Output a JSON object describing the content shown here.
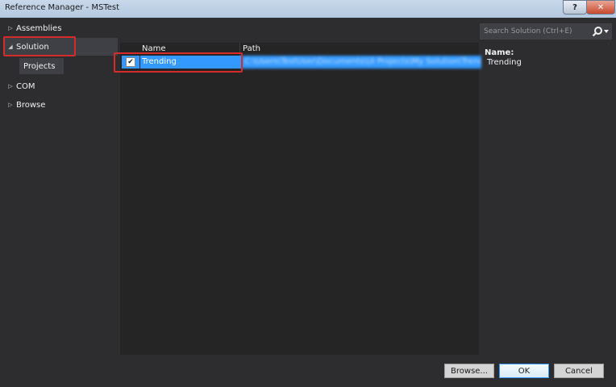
{
  "window": {
    "title": "Reference Manager - MSTest",
    "help_label": "?",
    "close_label": "✕"
  },
  "nav": {
    "items": [
      {
        "label": "Assemblies",
        "expanded": false
      },
      {
        "label": "Solution",
        "expanded": true,
        "selected": true
      },
      {
        "label": "COM",
        "expanded": false
      },
      {
        "label": "Browse",
        "expanded": false
      }
    ],
    "sub_item": "Projects",
    "collapsed_glyph": "▷",
    "expanded_glyph": "◢"
  },
  "grid": {
    "columns": [
      "Name",
      "Path"
    ],
    "rows": [
      {
        "checked": true,
        "check_glyph": "✔",
        "name": "Trending",
        "path": "C:\\Users\\TestUser\\Documents\\UI Projects\\My Solution\\Trending\\Trending.csproj"
      }
    ]
  },
  "search": {
    "placeholder": "Search Solution (Ctrl+E)",
    "value": ""
  },
  "details": {
    "name_label": "Name:",
    "name_value": "Trending"
  },
  "buttons": {
    "browse": "Browse...",
    "ok": "OK",
    "cancel": "Cancel"
  },
  "colors": {
    "background": "#2d2d30",
    "selection": "#3399ff",
    "highlight": "#d62b2b"
  }
}
